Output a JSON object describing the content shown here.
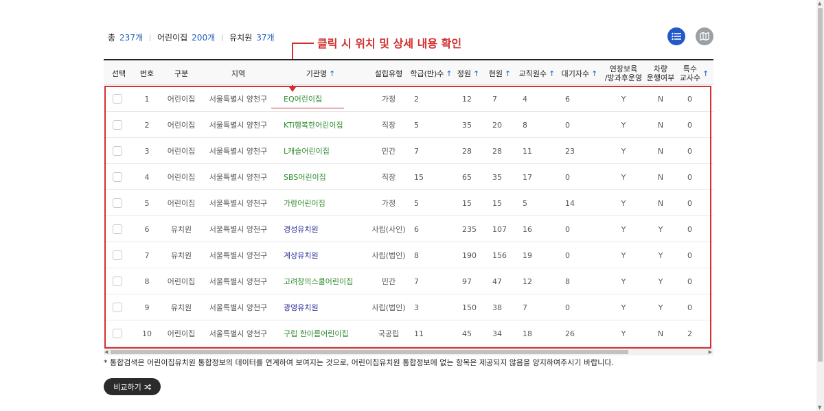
{
  "summary": {
    "total_label": "총",
    "total_count": "237개",
    "daycare_label": "어린이집",
    "daycare_count": "200개",
    "kinder_label": "유치원",
    "kinder_count": "37개"
  },
  "callout": "클릭 시 위치 및 상세 내용 확인",
  "view_buttons": {
    "list_icon": "list-icon",
    "map_icon": "map-icon"
  },
  "table": {
    "headers": {
      "select": "선택",
      "no": "번호",
      "type": "구분",
      "region": "지역",
      "name": "기관명",
      "est": "설립유형",
      "classes": "학급(반)수",
      "capacity": "정원",
      "current": "현원",
      "staff": "교직원수",
      "waiting": "대기자수",
      "extended_1": "연장보육",
      "extended_2": "/방과후운영",
      "vehicle_1": "차량",
      "vehicle_2": "운행여부",
      "special_1": "특수",
      "special_2": "교사수",
      "sort_icon": "↑"
    },
    "rows": [
      {
        "no": "1",
        "type": "어린이집",
        "region": "서울특별시 양천구",
        "name": "EQ어린이집",
        "est": "가정",
        "classes": "2",
        "capacity": "12",
        "current": "7",
        "staff": "4",
        "waiting": "6",
        "extended": "Y",
        "vehicle": "N",
        "special": "0"
      },
      {
        "no": "2",
        "type": "어린이집",
        "region": "서울특별시 양천구",
        "name": "KTi행복한어린이집",
        "est": "직장",
        "classes": "5",
        "capacity": "35",
        "current": "20",
        "staff": "8",
        "waiting": "0",
        "extended": "Y",
        "vehicle": "N",
        "special": "0"
      },
      {
        "no": "3",
        "type": "어린이집",
        "region": "서울특별시 양천구",
        "name": "L캐슬어린이집",
        "est": "민간",
        "classes": "7",
        "capacity": "28",
        "current": "28",
        "staff": "11",
        "waiting": "23",
        "extended": "Y",
        "vehicle": "N",
        "special": "0"
      },
      {
        "no": "4",
        "type": "어린이집",
        "region": "서울특별시 양천구",
        "name": "SBS어린이집",
        "est": "직장",
        "classes": "15",
        "capacity": "65",
        "current": "35",
        "staff": "17",
        "waiting": "0",
        "extended": "Y",
        "vehicle": "N",
        "special": "0"
      },
      {
        "no": "5",
        "type": "어린이집",
        "region": "서울특별시 양천구",
        "name": "가람어린이집",
        "est": "가정",
        "classes": "5",
        "capacity": "15",
        "current": "15",
        "staff": "5",
        "waiting": "14",
        "extended": "Y",
        "vehicle": "N",
        "special": "0"
      },
      {
        "no": "6",
        "type": "유치원",
        "region": "서울특별시 양천구",
        "name": "경성유치원",
        "est": "사립(사인)",
        "classes": "6",
        "capacity": "235",
        "current": "107",
        "staff": "16",
        "waiting": "0",
        "extended": "Y",
        "vehicle": "Y",
        "special": "0"
      },
      {
        "no": "7",
        "type": "유치원",
        "region": "서울특별시 양천구",
        "name": "계상유치원",
        "est": "사립(법인)",
        "classes": "8",
        "capacity": "190",
        "current": "156",
        "staff": "19",
        "waiting": "0",
        "extended": "Y",
        "vehicle": "Y",
        "special": "0"
      },
      {
        "no": "8",
        "type": "어린이집",
        "region": "서울특별시 양천구",
        "name": "고려창의스쿨어린이집",
        "est": "민간",
        "classes": "7",
        "capacity": "97",
        "current": "47",
        "staff": "12",
        "waiting": "8",
        "extended": "Y",
        "vehicle": "Y",
        "special": "0"
      },
      {
        "no": "9",
        "type": "유치원",
        "region": "서울특별시 양천구",
        "name": "광영유치원",
        "est": "사립(법인)",
        "classes": "3",
        "capacity": "150",
        "current": "38",
        "staff": "7",
        "waiting": "0",
        "extended": "Y",
        "vehicle": "Y",
        "special": "0"
      },
      {
        "no": "10",
        "type": "어린이집",
        "region": "서울특별시 양천구",
        "name": "구립 한아름어린이집",
        "est": "국공립",
        "classes": "11",
        "capacity": "45",
        "current": "34",
        "staff": "18",
        "waiting": "26",
        "extended": "Y",
        "vehicle": "N",
        "special": "2"
      }
    ]
  },
  "note": "* 통합검색은 어린이집유치원 통합정보의 데이터를 연계하여 보여지는 것으로, 어린이집유치원 통합정보에 없는 항목은 제공되지 않음을 양지하여주시기 바랍니다.",
  "compare_button": {
    "label": "비교하기",
    "icon": "shuffle-icon"
  },
  "colors": {
    "accent": "#2159c9",
    "callout": "#d32f2f",
    "daycare_name": "#2e8b2e",
    "kinder_name": "#2a2a9a"
  }
}
